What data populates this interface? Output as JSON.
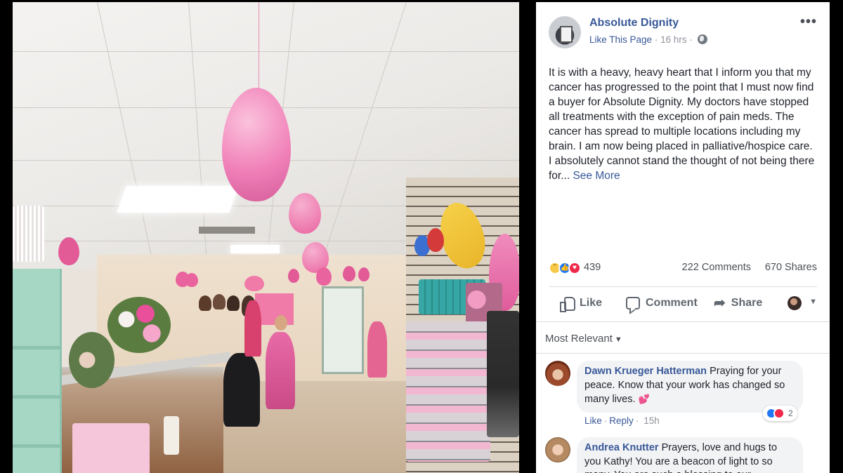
{
  "post": {
    "page_name": "Absolute Dignity",
    "like_page": "Like This Page",
    "time": "16 hrs",
    "meta_sep": "·",
    "text_lines": [
      "It is with a heavy, heavy heart that I inform you that my cancer has progressed to the point that I must now find a buyer for Absolute Dignity. My doctors have stopped all treatments with the exception of pain meds. The cancer has spread to multiple locations including my brain. I am now being placed in palliative/hospice care.",
      "I absolutely cannot stand the thought of not being there for..."
    ],
    "see_more": "See More",
    "reaction_count": "439",
    "comments": "222 Comments",
    "shares": "670 Shares",
    "reaction_types": [
      "sad",
      "like",
      "love"
    ]
  },
  "actions": {
    "like": "Like",
    "comment": "Comment",
    "share": "Share"
  },
  "comments_section": {
    "sort": "Most Relevant",
    "items": [
      {
        "author": "Dawn Krueger Hatterman",
        "text": "Praying for your peace. Know that your work has changed so many lives.",
        "reaction_count": "2",
        "like": "Like",
        "reply": "Reply",
        "time": "15h"
      },
      {
        "author": "Andrea Knutter",
        "text": "Prayers, love and hugs to you Kathy! You are a beacon of light to so many. You are such a blessing to our..."
      }
    ]
  },
  "icons": {
    "more": "ellipsis-icon",
    "globe": "globe-icon",
    "like": "thumbs-up-icon",
    "comment": "comment-icon",
    "share": "share-arrow-icon"
  },
  "colors": {
    "link": "#385898",
    "text": "#1d2129",
    "muted": "#90949c",
    "like_blue": "#2078f4",
    "love_red": "#f0284a"
  }
}
